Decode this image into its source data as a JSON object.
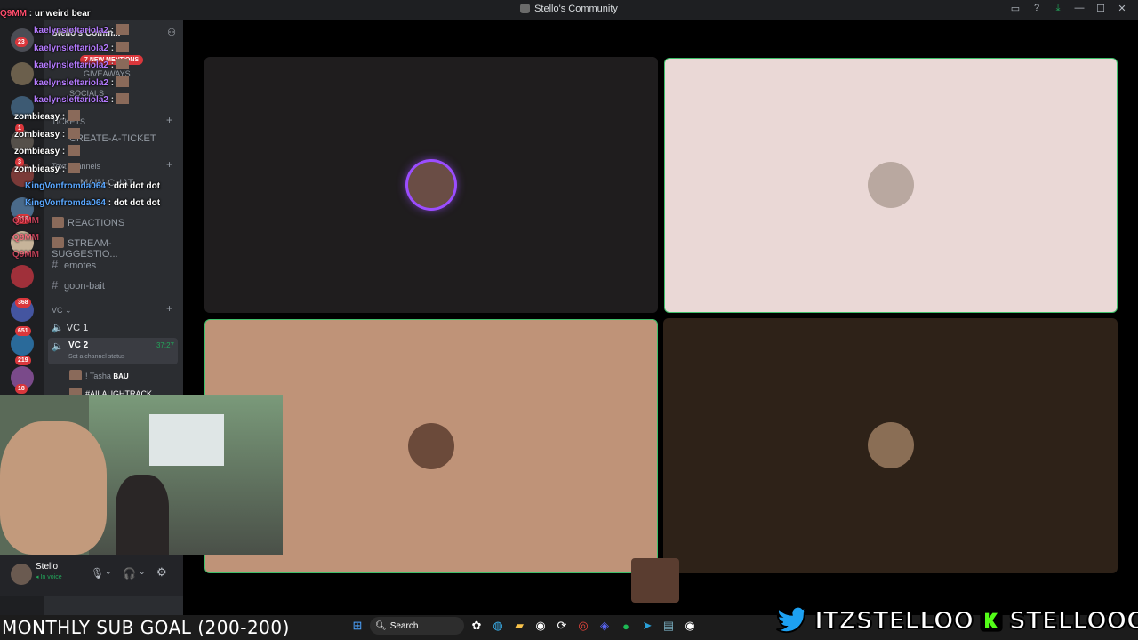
{
  "window": {
    "title": "Stello's Community",
    "controls": [
      "inbox-icon",
      "help-icon",
      "download-icon",
      "minimize-icon",
      "maximize-icon",
      "close-icon"
    ]
  },
  "servers": {
    "badges": [
      "23",
      "1",
      "3",
      "313",
      "368",
      "651",
      "219",
      "18"
    ]
  },
  "channels": {
    "server_name": "Stello's Comm...",
    "mentions_banner": "7 NEW MENTIONS",
    "items_top": [
      "GIVEAWAYS",
      "SOCIALS"
    ],
    "category_1": "TICKETS",
    "ticket_channel": "CREATE-A-TICKET",
    "category_2": "Text channels",
    "text_channels": [
      "MAIN-CHAT",
      "REACTIONS",
      "STREAM-SUGGESTIO...",
      "emotes",
      "goon-bait"
    ],
    "voice_category": "VC",
    "voice_channels": [
      {
        "name": "VC 1",
        "time": ""
      },
      {
        "name": "VC 2",
        "time": "37:27",
        "status": "Set a channel status"
      }
    ],
    "voice_members": [
      "! Tasha",
      "BAU",
      "#AILAUGHTRACK"
    ]
  },
  "user_panel": {
    "name": "Stello",
    "status": "In voice"
  },
  "chat": [
    {
      "user": "Q9MM",
      "message": "ur weird bear",
      "color": "#ff4d6d"
    },
    {
      "user": "kaelynsleftariola2",
      "message": "",
      "color": "#b57bff",
      "emote": true
    },
    {
      "user": "kaelynsleftariola2",
      "message": "",
      "color": "#b57bff",
      "emote": true
    },
    {
      "user": "kaelynsleftariola2",
      "message": "",
      "color": "#b57bff",
      "emote": true
    },
    {
      "user": "kaelynsleftariola2",
      "message": "",
      "color": "#b57bff",
      "emote": true
    },
    {
      "user": "kaelynsleftariola2",
      "message": "",
      "color": "#b57bff",
      "emote": true
    },
    {
      "user": "zombieasy",
      "message": "",
      "color": "#ffffff",
      "emote": true
    },
    {
      "user": "zombieasy",
      "message": "",
      "color": "#ffffff",
      "emote": true
    },
    {
      "user": "zombieasy",
      "message": "",
      "color": "#ffffff",
      "emote": true
    },
    {
      "user": "zombieasy",
      "message": "",
      "color": "#ffffff",
      "emote": true
    },
    {
      "user": "KingVonfromda064",
      "message": "dot dot dot",
      "color": "#5aa7ff"
    },
    {
      "user": "KingVonfromda064",
      "message": "dot dot dot",
      "color": "#5aa7ff"
    },
    {
      "user": "Q9MM",
      "message": "",
      "color": "#ff4d6d"
    },
    {
      "user": "Q9MM",
      "message": "",
      "color": "#ff4d6d"
    },
    {
      "user": "Q9MM",
      "message": "",
      "color": "#ff4d6d"
    }
  ],
  "stage": {
    "tiles": [
      {
        "bg": "#1f1d1e",
        "speaking": false
      },
      {
        "bg": "#ead8d6",
        "speaking": true
      },
      {
        "bg": "#bf9378",
        "speaking": true
      },
      {
        "bg": "#2e2218",
        "speaking": false
      }
    ]
  },
  "overlay": {
    "sub_goal": "MONTHLY SUB GOAL (200-200)",
    "twitter": "ITZSTELLOO",
    "kick": "STELLOOO"
  },
  "taskbar": {
    "search_label": "Search"
  },
  "colors": {
    "discord_dark": "#1e1f22",
    "channel_bg": "#2b2d31",
    "speaking_green": "#23a55a",
    "mention_red": "#da373c",
    "kick_green": "#53fc18",
    "twitter_blue": "#1da1f2"
  }
}
